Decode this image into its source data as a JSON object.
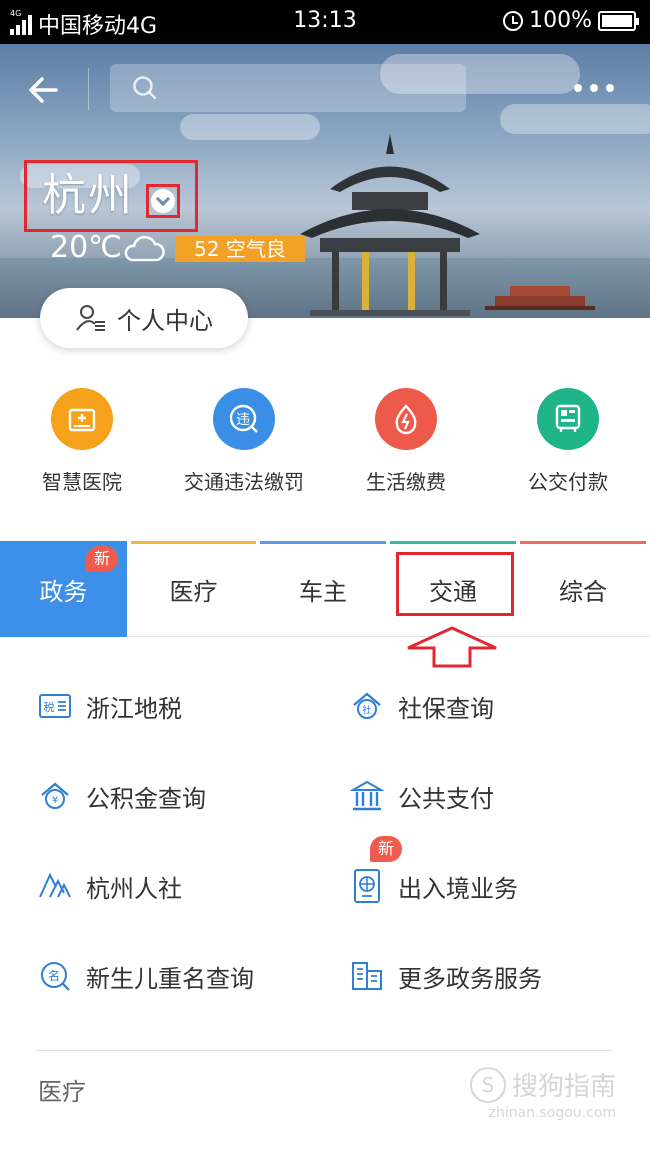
{
  "status_bar": {
    "network_tag": "4G",
    "carrier": "中国移动4G",
    "time": "13:13",
    "battery": "100%"
  },
  "hero": {
    "city": "杭州",
    "temperature": "20℃",
    "aqi": "52 空气良"
  },
  "personal_center": {
    "label": "个人中心"
  },
  "quick_services": [
    {
      "label": "智慧医院",
      "color": "#f5a21a",
      "icon": "hospital-icon"
    },
    {
      "label": "交通违法缴罚",
      "color": "#3a8ee6",
      "icon": "violation-icon"
    },
    {
      "label": "生活缴费",
      "color": "#ee5a4a",
      "icon": "utility-icon"
    },
    {
      "label": "公交付款",
      "color": "#20b48a",
      "icon": "bus-pay-icon"
    }
  ],
  "tabs": [
    {
      "label": "政务",
      "badge": "新",
      "active": true,
      "line": "#3d8fe8"
    },
    {
      "label": "医疗",
      "line": "#f0b43c"
    },
    {
      "label": "车主",
      "line": "#5a9be6"
    },
    {
      "label": "交通",
      "line": "#34b9a8"
    },
    {
      "label": "综合",
      "line": "#ef6b5c"
    }
  ],
  "services": [
    {
      "label": "浙江地税",
      "icon": "tax-icon"
    },
    {
      "label": "社保查询",
      "icon": "social-security-icon"
    },
    {
      "label": "公积金查询",
      "icon": "housing-fund-icon"
    },
    {
      "label": "公共支付",
      "icon": "public-payment-icon"
    },
    {
      "label": "杭州人社",
      "icon": "hr-icon"
    },
    {
      "label": "出入境业务",
      "icon": "passport-icon",
      "badge": "新"
    },
    {
      "label": "新生儿重名查询",
      "icon": "name-query-icon"
    },
    {
      "label": "更多政务服务",
      "icon": "more-services-icon"
    }
  ],
  "sections": {
    "medical": "医疗"
  },
  "watermark": {
    "text": "搜狗指南",
    "url": "zhinan.sogou.com"
  },
  "colors": {
    "accent": "#3d8fe8",
    "highlight": "#e0282e",
    "service_icon": "#2f7fd6"
  }
}
